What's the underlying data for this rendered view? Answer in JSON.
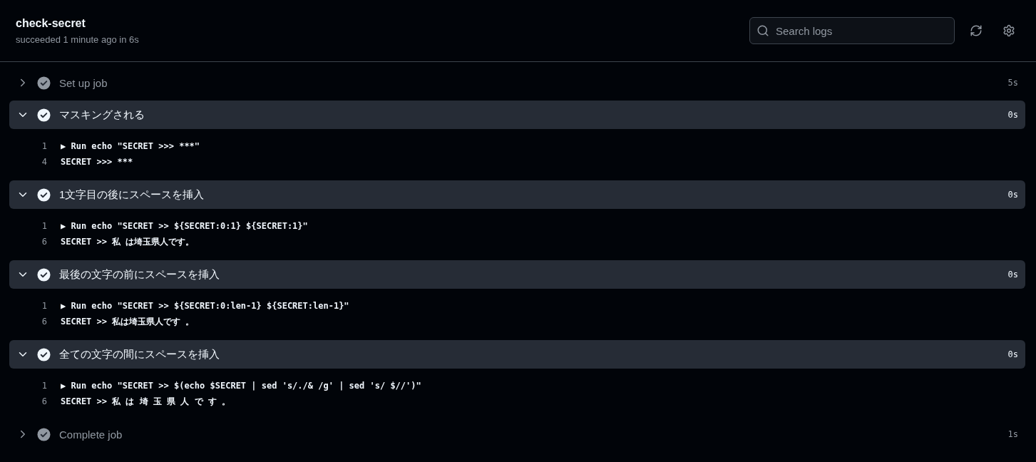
{
  "header": {
    "title": "check-secret",
    "subtitle": "succeeded 1 minute ago in 6s",
    "search": {
      "placeholder": "Search logs"
    }
  },
  "steps": [
    {
      "name": "Set up job",
      "expanded": false,
      "duration": "5s"
    },
    {
      "name": "マスキングされる",
      "expanded": true,
      "duration": "0s",
      "lines": [
        {
          "number": "1",
          "text": "▶ Run echo \"SECRET >>> ***\""
        },
        {
          "number": "4",
          "text": "SECRET >>> ***"
        }
      ]
    },
    {
      "name": "1文字目の後にスペースを挿入",
      "expanded": true,
      "duration": "0s",
      "lines": [
        {
          "number": "1",
          "text": "▶ Run echo \"SECRET >> ${SECRET:0:1} ${SECRET:1}\""
        },
        {
          "number": "6",
          "text": "SECRET >> 私 は埼玉県人です。"
        }
      ]
    },
    {
      "name": "最後の文字の前にスペースを挿入",
      "expanded": true,
      "duration": "0s",
      "lines": [
        {
          "number": "1",
          "text": "▶ Run echo \"SECRET >> ${SECRET:0:len-1} ${SECRET:len-1}\""
        },
        {
          "number": "6",
          "text": "SECRET >> 私は埼玉県人です 。"
        }
      ]
    },
    {
      "name": "全ての文字の間にスペースを挿入",
      "expanded": true,
      "duration": "0s",
      "lines": [
        {
          "number": "1",
          "text": "▶ Run echo \"SECRET >> $(echo $SECRET | sed 's/./& /g' | sed 's/ $//')\""
        },
        {
          "number": "6",
          "text": "SECRET >> 私 は 埼 玉 県 人 で す 。"
        }
      ]
    },
    {
      "name": "Complete job",
      "expanded": false,
      "duration": "1s"
    }
  ]
}
